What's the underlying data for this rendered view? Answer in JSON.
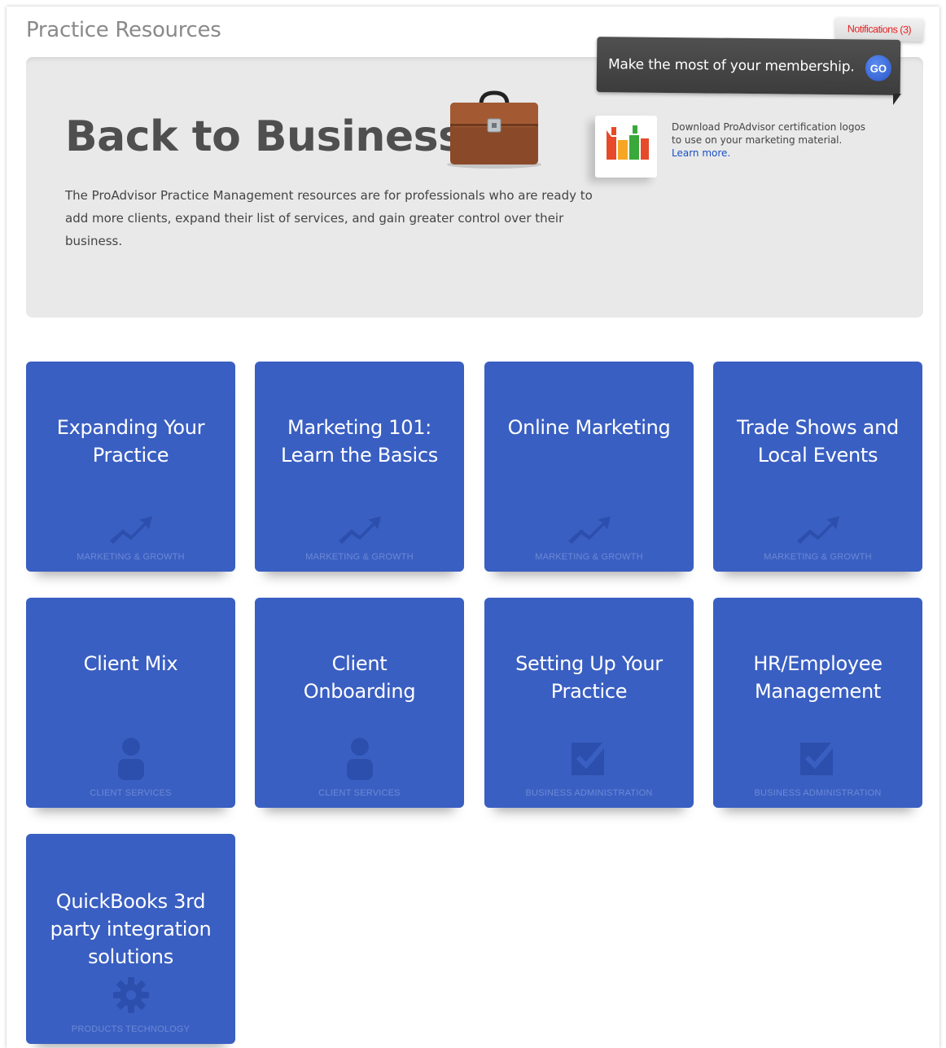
{
  "header": {
    "title": "Practice Resources",
    "notifications": "Notifications (3)"
  },
  "hero": {
    "title": "Back to Business",
    "description": "The ProAdvisor Practice Management resources are for professionals who are ready to add more clients, expand their list of services, and gain greater control over their business.",
    "membership": {
      "text": "Make the most of your membership.",
      "go": "GO"
    },
    "certification": {
      "text": "Download ProAdvisor certification logos to use on your marketing material.",
      "link": "Learn more."
    }
  },
  "tiles": [
    {
      "title_lines": [
        "Expanding Your",
        "Practice"
      ],
      "category": "MARKETING & GROWTH",
      "icon": "growth-arrow-icon"
    },
    {
      "title_lines": [
        "Marketing 101:",
        "Learn the Basics"
      ],
      "category": "MARKETING & GROWTH",
      "icon": "growth-arrow-icon"
    },
    {
      "title_lines": [
        "Online Marketing"
      ],
      "category": "MARKETING & GROWTH",
      "icon": "growth-arrow-icon"
    },
    {
      "title_lines": [
        "Trade Shows and",
        "Local Events"
      ],
      "category": "MARKETING & GROWTH",
      "icon": "growth-arrow-icon"
    },
    {
      "title_lines": [
        "Client Mix"
      ],
      "category": "CLIENT SERVICES",
      "icon": "person-icon"
    },
    {
      "title_lines": [
        "Client",
        "Onboarding"
      ],
      "category": "CLIENT SERVICES",
      "icon": "person-icon"
    },
    {
      "title_lines": [
        "Setting Up Your",
        "Practice"
      ],
      "category": "BUSINESS ADMINISTRATION",
      "icon": "checkbox-icon"
    },
    {
      "title_lines": [
        "HR/Employee",
        "Management"
      ],
      "category": "BUSINESS ADMINISTRATION",
      "icon": "checkbox-icon"
    },
    {
      "title_lines": [
        "QuickBooks 3rd",
        "party integration",
        "solutions"
      ],
      "category": "PRODUCTS TECHNOLOGY",
      "icon": "gear-icon"
    }
  ],
  "colors": {
    "tile": "#3a5fc2",
    "tile_icon": "#2c4fae",
    "category_text": "#6c89d6",
    "notification_text": "#e52222",
    "go_button": "#2a57c9"
  }
}
